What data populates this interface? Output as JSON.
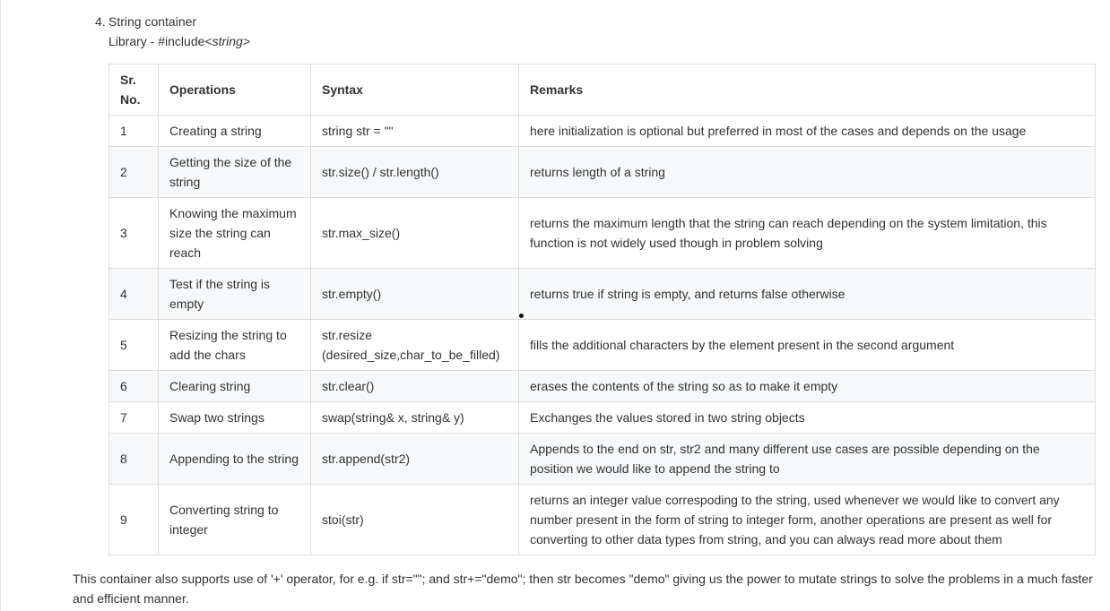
{
  "heading": {
    "number": "4.",
    "title": "String container"
  },
  "library": {
    "prefix": "Library - #include",
    "include": "<string>"
  },
  "table": {
    "headers": [
      "Sr. No.",
      "Operations",
      "Syntax",
      "Remarks"
    ],
    "rows": [
      [
        "1",
        "Creating a string",
        "string str = \"\"",
        "here initialization is optional but preferred in most of the cases and depends on the usage"
      ],
      [
        "2",
        "Getting the size of the string",
        "str.size() / str.length()",
        "returns length of a string"
      ],
      [
        "3",
        "Knowing the maximum size the string can reach",
        "str.max_size()",
        "returns the maximum length that the string can reach depending on the system limitation, this function is not widely used though in problem solving"
      ],
      [
        "4",
        "Test if the string is empty",
        "str.empty()",
        "returns true if string is empty, and returns false otherwise"
      ],
      [
        "5",
        "Resizing the string to add the chars",
        "str.resize (desired_size,char_to_be_filled)",
        "fills the additional characters by the element present in the second argument"
      ],
      [
        "6",
        "Clearing string",
        "str.clear()",
        "erases the contents of the string so as to make it empty"
      ],
      [
        "7",
        "Swap two strings",
        "swap(string& x, string& y)",
        "Exchanges the values stored in two string objects"
      ],
      [
        "8",
        "Appending to the string",
        "str.append(str2)",
        "Appends to the end on str, str2 and many different use cases are possible depending on the position we would like to append the string to"
      ],
      [
        "9",
        "Converting string to integer",
        "stoi(str)",
        "returns an integer value correspoding to the string, used whenever we would like to convert any number present in the form of string to integer form, another operations are present as well for converting to other data types from string, and you can always read more about them"
      ]
    ]
  },
  "footer": "This container also supports use of '+' operator, for e.g. if str=\"\"; and str+=\"demo\"; then str becomes \"demo\" giving us the power to mutate strings to solve the problems in a much faster and efficient manner."
}
